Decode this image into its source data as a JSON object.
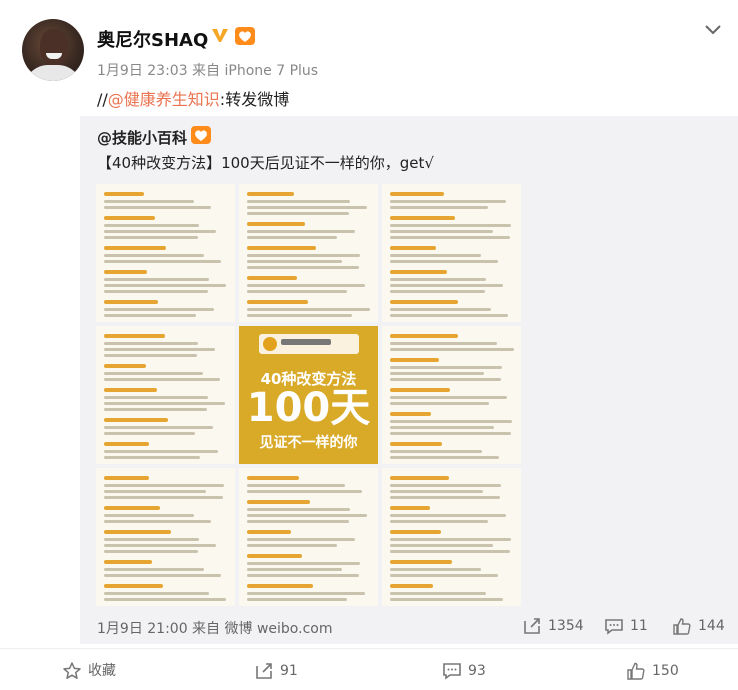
{
  "post": {
    "username": "奥尼尔SHAQ",
    "verified_icon": "verified-v-icon",
    "fan_badge_icon": "fan-badge-icon",
    "meta": "1月9日 23:03 来自 iPhone 7 Plus",
    "text_prefix": "//",
    "mention": "@健康养生知识",
    "text_suffix": ":转发微博"
  },
  "repost": {
    "original_user": "@技能小百科",
    "original_text": "【40种改变方法】100天后见证不一样的你，get√",
    "poster": {
      "line1": "40种改变方法",
      "line2": "100天",
      "line3": "见证不一样的你"
    },
    "meta": "1月9日 21:00 来自 微博 weibo.com",
    "reposts": "1354",
    "comments": "11",
    "likes": "144"
  },
  "actions": {
    "favorite": "收藏",
    "repost": "91",
    "comment": "93",
    "like": "150"
  },
  "colors": {
    "accent_link": "#eb7350",
    "badge_orange": "#ff8b1a",
    "verified_gold": "#f5a623"
  }
}
